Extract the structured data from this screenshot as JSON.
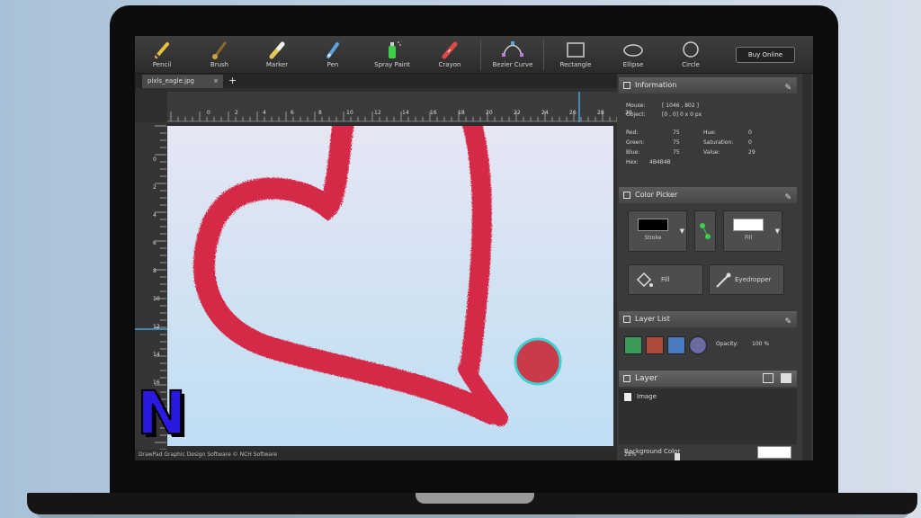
{
  "toolbar": {
    "tools": [
      {
        "label": "Pencil",
        "icon": "pencil-icon",
        "color": "#e8c13a"
      },
      {
        "label": "Brush",
        "icon": "brush-icon",
        "color": "#c9a33a"
      },
      {
        "label": "Marker",
        "icon": "marker-icon",
        "color": "#e0c85a"
      },
      {
        "label": "Pen",
        "icon": "pen-icon",
        "color": "#5aa6e0"
      },
      {
        "label": "Spray Paint",
        "icon": "spray-paint-icon",
        "color": "#3ecf4a"
      },
      {
        "label": "Crayon",
        "icon": "crayon-icon",
        "color": "#e04848"
      },
      {
        "label": "Bezier Curve",
        "icon": "bezier-curve-icon",
        "color": "#b77ae0"
      },
      {
        "label": "Rectangle",
        "icon": "rectangle-icon",
        "color": "#cfcfcf"
      },
      {
        "label": "Ellipse",
        "icon": "ellipse-icon",
        "color": "#cfcfcf"
      },
      {
        "label": "Circle",
        "icon": "circle-icon",
        "color": "#cfcfcf"
      }
    ],
    "buy_label": "Buy Online"
  },
  "tab": {
    "name": "pixls_eagle.jpg",
    "close": "×",
    "add": "+"
  },
  "ruler": {
    "h_ticks": [
      "0",
      "2",
      "4",
      "6",
      "8",
      "10",
      "12",
      "14",
      "16",
      "18",
      "20",
      "22",
      "24",
      "26",
      "28",
      "30"
    ],
    "v_ticks": [
      "0",
      "2",
      "4",
      "6",
      "8",
      "10",
      "12",
      "14",
      "16",
      "18"
    ]
  },
  "status_text": "DrawPad Graphic Design Software © NCH Software",
  "information": {
    "title": "Information",
    "mouse_label": "Mouse:",
    "mouse_value": "[ 1046 , 802 ]",
    "object_label": "Object:",
    "object_value": "[0 , 0] 0 x 0 px",
    "red_label": "Red:",
    "red_value": "75",
    "hue_label": "Hue:",
    "hue_value": "0",
    "green_label": "Green:",
    "green_value": "75",
    "sat_label": "Saturation:",
    "sat_value": "0",
    "blue_label": "Blue:",
    "blue_value": "75",
    "val_label": "Value:",
    "val_value": "29",
    "hex_label": "Hex:",
    "hex_value": "4B4B4B"
  },
  "color_picker": {
    "title": "Color Picker",
    "stroke_label": "Stroke",
    "fill_label": "Fill",
    "fill_button": "Fill",
    "eyedropper_button": "Eyedropper",
    "stroke_color": "#000000",
    "fill_color": "#ffffff"
  },
  "layer_list": {
    "title": "Layer List",
    "opacity_label": "Opacity:",
    "opacity_value": "100 %"
  },
  "layer": {
    "title": "Layer",
    "item": "Image",
    "background_label": "Background Color"
  },
  "zoom_value": "28%",
  "logo_letter": "N",
  "colors": {
    "heart": "#d42a47",
    "dot": "#c93a4a",
    "dot_ring": "#3fd0d0"
  }
}
